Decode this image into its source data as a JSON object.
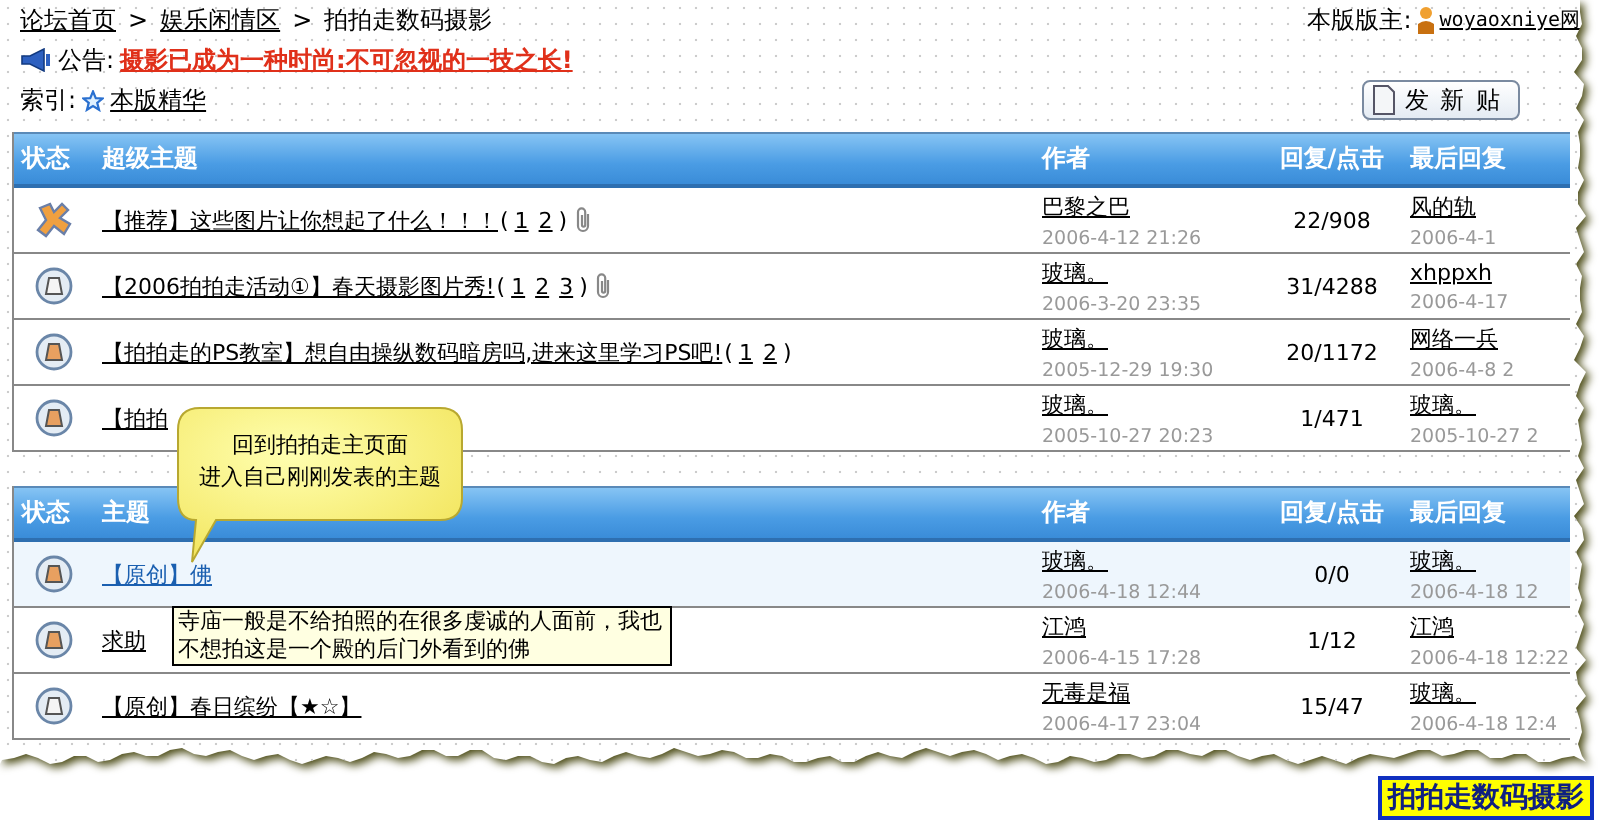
{
  "breadcrumb": {
    "separator": ">",
    "items": [
      "论坛首页",
      "娱乐闲情区",
      "拍拍走数码摄影"
    ]
  },
  "moderator": {
    "label": "本版版主:",
    "name": "woyaoxniye网"
  },
  "announcement": {
    "label": "公告:",
    "text": "摄影已成为一种时尚:不可忽视的一技之长!"
  },
  "index": {
    "label": "索引:",
    "link": "本版精华"
  },
  "new_post_button": "发 新 贴",
  "page_brackets": [
    "(",
    ")"
  ],
  "tables": [
    {
      "columns": [
        "状态",
        "超级主题",
        "作者",
        "回复/点击",
        "最后回复"
      ],
      "rows": [
        {
          "kind": "pinned",
          "title": "【推荐】这些图片让你想起了什么！！！",
          "pages": [
            "1",
            "2"
          ],
          "attachment": true,
          "author": "巴黎之巴",
          "date": "2006-4-12 21:26",
          "stats": "22/908",
          "last_author": "风的轨",
          "last_date": "2006-4-1",
          "selected": false
        },
        {
          "kind": "normal",
          "title": "【2006拍拍走活动①】春天摄影图片秀!",
          "pages": [
            "1",
            "2",
            "3"
          ],
          "attachment": true,
          "author": "玻璃。",
          "date": "2006-3-20 23:35",
          "stats": "31/4288",
          "last_author": "xhppxh",
          "last_date": "2006-4-17",
          "selected": false
        },
        {
          "kind": "hot",
          "title": "【拍拍走的PS教室】想自由操纵数码暗房吗,进来这里学习PS吧!",
          "pages": [
            "1",
            "2"
          ],
          "attachment": false,
          "author": "玻璃。",
          "date": "2005-12-29 19:30",
          "stats": "20/1172",
          "last_author": "网络一兵",
          "last_date": "2006-4-8 2",
          "selected": false
        },
        {
          "kind": "hot",
          "title": "【拍拍",
          "pages": [],
          "attachment": false,
          "author": "玻璃。",
          "date": "2005-10-27 20:23",
          "stats": "1/471",
          "last_author": "玻璃。",
          "last_date": "2005-10-27 2",
          "selected": false
        }
      ]
    },
    {
      "columns": [
        "状态",
        "主题",
        "作者",
        "回复/点击",
        "最后回复"
      ],
      "rows": [
        {
          "kind": "hot",
          "title": "【原创】佛",
          "pages": [],
          "attachment": false,
          "author": "玻璃。",
          "date": "2006-4-18 12:44",
          "stats": "0/0",
          "last_author": "玻璃。",
          "last_date": "2006-4-18 12",
          "selected": true
        },
        {
          "kind": "hot",
          "title": "求助",
          "pages": [],
          "attachment": false,
          "author": "江鸿",
          "date": "2006-4-15 17:28",
          "stats": "1/12",
          "last_author": "江鸿",
          "last_date": "2006-4-18 12:22",
          "selected": false
        },
        {
          "kind": "normal",
          "title": "【原创】春日缤纷【★☆】",
          "pages": [],
          "attachment": false,
          "author": "无毒是福",
          "date": "2006-4-17 23:04",
          "stats": "15/47",
          "last_author": "玻璃。",
          "last_date": "2006-4-18 12:4",
          "selected": false
        }
      ]
    }
  ],
  "callout": [
    "回到拍拍走主页面",
    "进入自己刚刚发表的主题"
  ],
  "hover_tooltip": "寺庙一般是不给拍照的在很多虔诚的人面前，我也不想拍这是一个殿的后门外看到的佛",
  "caption": "拍拍走数码摄影"
}
